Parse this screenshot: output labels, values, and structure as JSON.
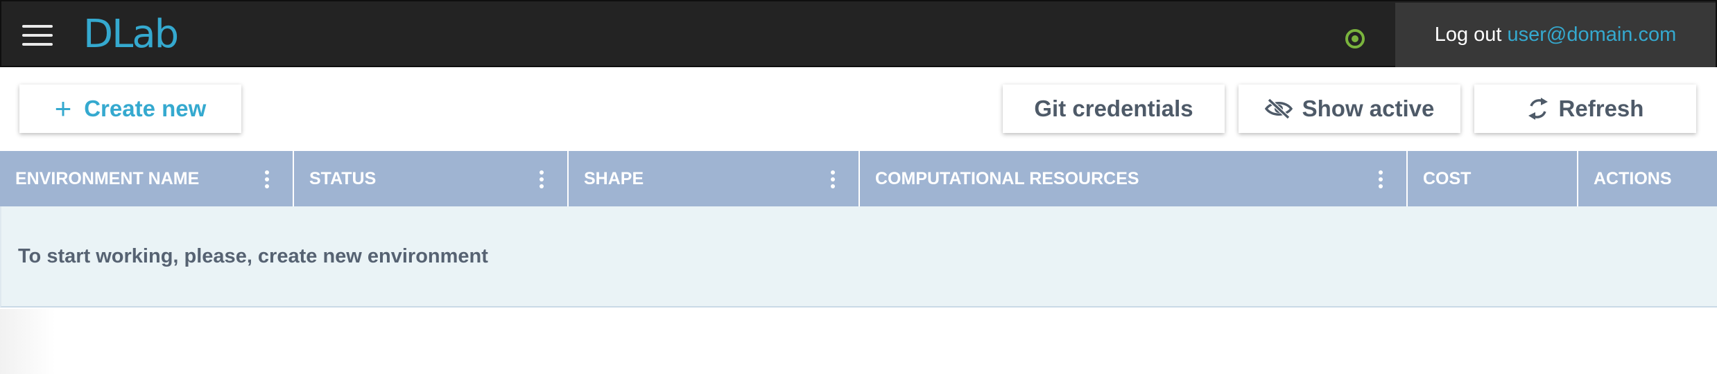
{
  "app": {
    "logo_text": "DLab",
    "brand_color": "#35a9cf",
    "status_color": "#7ab43d"
  },
  "header": {
    "logout_label": "Log out",
    "user_email": "user@domain.com",
    "menu_icon": "hamburger-menu-icon",
    "status_icon": "connection-status-icon"
  },
  "toolbar": {
    "create_icon": "plus-icon",
    "create_label": "Create new",
    "git_label": "Git credentials",
    "show_active_icon": "eye-slash-icon",
    "show_active_label": "Show active",
    "refresh_icon": "refresh-icon",
    "refresh_label": "Refresh"
  },
  "table": {
    "columns": [
      {
        "label": "ENVIRONMENT NAME",
        "has_menu": true
      },
      {
        "label": "STATUS",
        "has_menu": true
      },
      {
        "label": "SHAPE",
        "has_menu": true
      },
      {
        "label": "COMPUTATIONAL RESOURCES",
        "has_menu": true
      },
      {
        "label": "COST",
        "has_menu": false
      },
      {
        "label": "ACTIONS",
        "has_menu": false
      }
    ],
    "empty_message": "To start working, please, create new environment"
  }
}
